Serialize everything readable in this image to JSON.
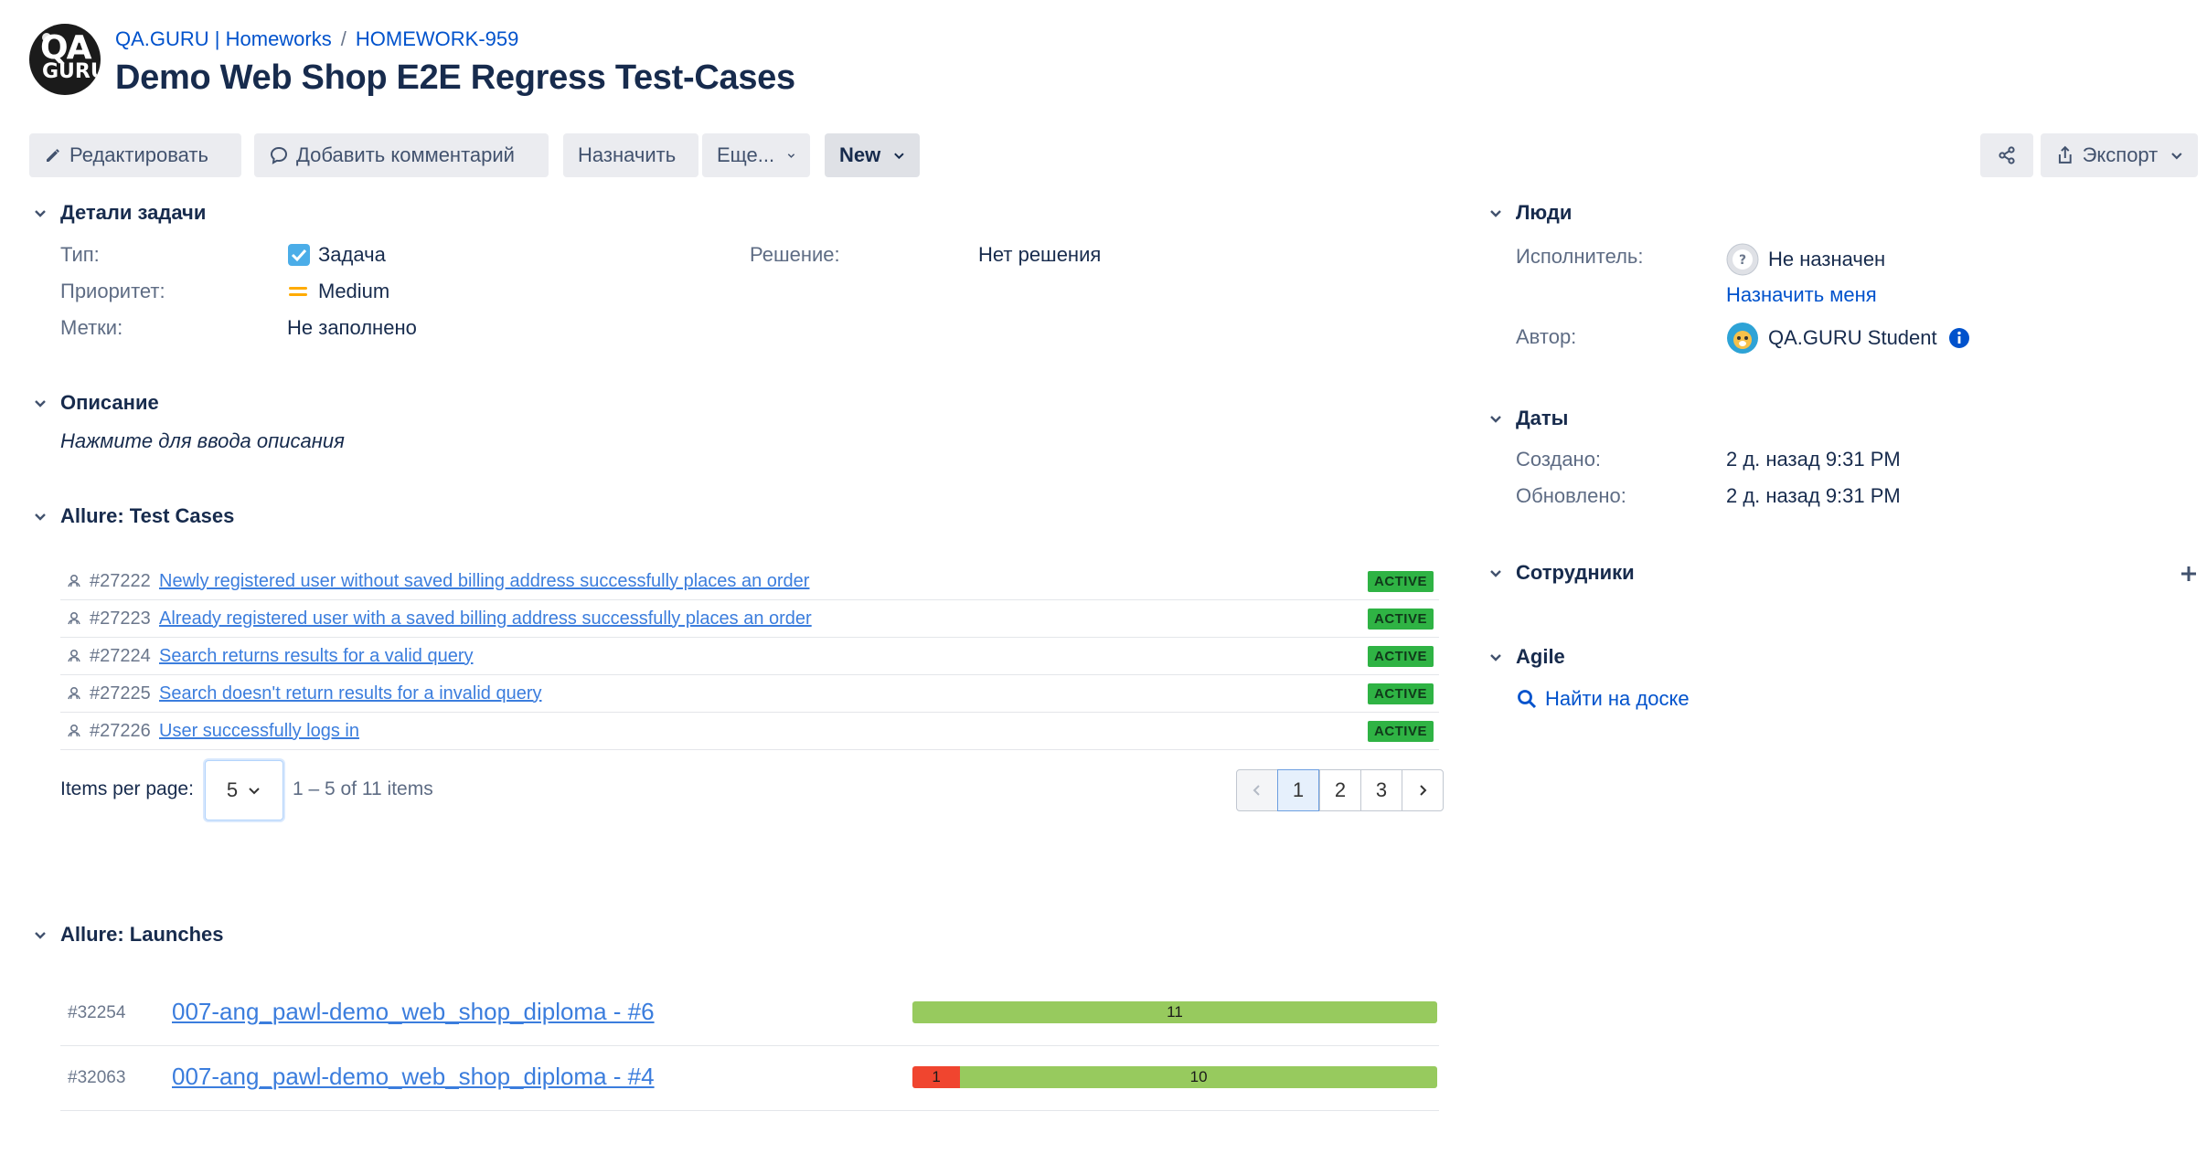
{
  "header": {
    "logo_text_top": "QA",
    "logo_text_bottom": "GURU",
    "breadcrumb": [
      "QA.GURU | Homeworks",
      "HOMEWORK-959"
    ],
    "separator": "/",
    "title": "Demo Web Shop E2E Regress Test-Cases"
  },
  "toolbar": {
    "edit_label": "Редактировать",
    "comment_label": "Добавить комментарий",
    "assign_label": "Назначить",
    "more_label": "Еще...",
    "status_label": "New",
    "export_label": "Экспорт"
  },
  "details": {
    "heading": "Детали задачи",
    "type_label": "Тип:",
    "type_value": "Задача",
    "priority_label": "Приоритет:",
    "priority_value": "Medium",
    "labels_label": "Метки:",
    "labels_value": "Не заполнено",
    "resolution_label": "Решение:",
    "resolution_value": "Нет решения"
  },
  "description": {
    "heading": "Описание",
    "placeholder": "Нажмите для ввода описания"
  },
  "test_cases": {
    "heading": "Allure: Test Cases",
    "rows": [
      {
        "id": "#27222",
        "title": "Newly registered user without saved billing address successfully places an order",
        "status": "ACTIVE"
      },
      {
        "id": "#27223",
        "title": "Already registered user with a saved billing address successfully places an order",
        "status": "ACTIVE"
      },
      {
        "id": "#27224",
        "title": "Search returns results for a valid query",
        "status": "ACTIVE"
      },
      {
        "id": "#27225",
        "title": "Search doesn't return results for a invalid query",
        "status": "ACTIVE"
      },
      {
        "id": "#27226",
        "title": "User successfully logs in",
        "status": "ACTIVE"
      }
    ],
    "items_per_page_label": "Items per page:",
    "items_per_page_value": "5",
    "range_text": "1 – 5 of 11 items",
    "pages": [
      "1",
      "2",
      "3"
    ],
    "current_page": "1"
  },
  "launches": {
    "heading": "Allure: Launches",
    "rows": [
      {
        "id": "#32254",
        "name": "007-ang_pawl-demo_web_shop_diploma - #6",
        "failed": 0,
        "passed": 11,
        "passed_label": "11",
        "failed_label": ""
      },
      {
        "id": "#32063",
        "name": "007-ang_pawl-demo_web_shop_diploma - #4",
        "failed": 1,
        "passed": 10,
        "passed_label": "10",
        "failed_label": "1"
      }
    ]
  },
  "people": {
    "heading": "Люди",
    "assignee_label": "Исполнитель:",
    "assignee_value": "Не назначен",
    "assign_me": "Назначить меня",
    "author_label": "Автор:",
    "author_value": "QA.GURU Student"
  },
  "dates": {
    "heading": "Даты",
    "created_label": "Создано:",
    "created_value": "2 д. назад 9:31 PM",
    "updated_label": "Обновлено:",
    "updated_value": "2 д. назад 9:31 PM"
  },
  "employees": {
    "heading": "Сотрудники"
  },
  "agile": {
    "heading": "Agile",
    "find_on_board": "Найти на доске"
  },
  "colors": {
    "link": "#0052cc",
    "badge_active": "#2fb344",
    "bar_passed": "#97ca5e",
    "bar_failed": "#f0452f",
    "priority_medium": "#ffab00"
  }
}
